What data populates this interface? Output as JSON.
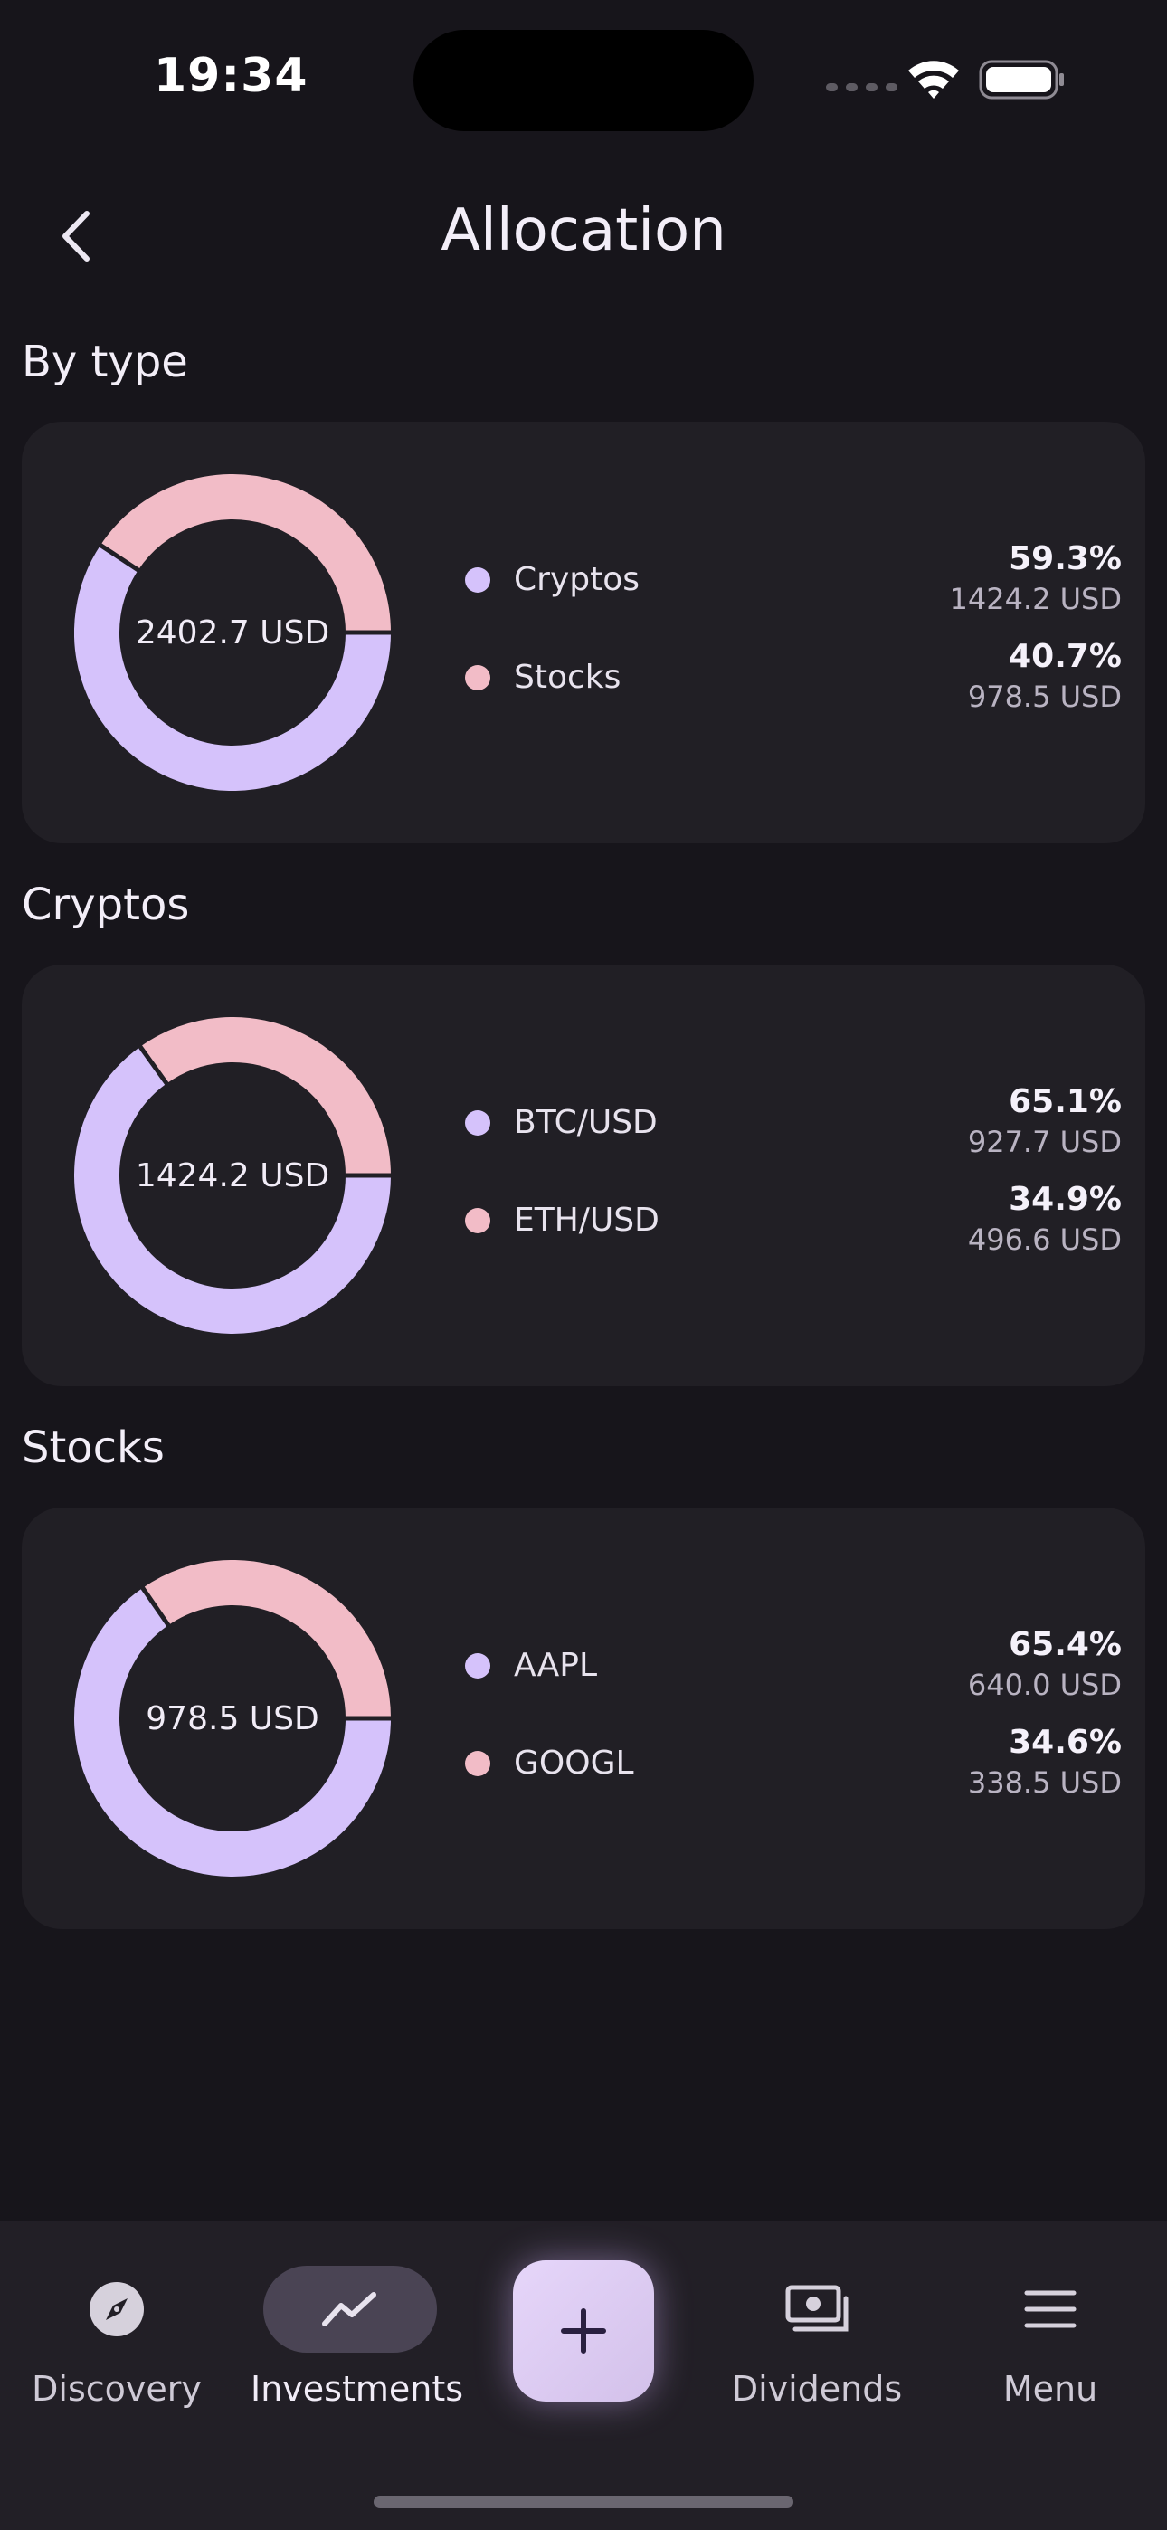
{
  "status_bar": {
    "time": "19:34"
  },
  "header": {
    "title": "Allocation",
    "back_icon": "chevron-left-icon"
  },
  "colors": {
    "primary": "#d5c2fb",
    "secondary": "#f2bcc7"
  },
  "sections": [
    {
      "title": "By type",
      "total": "2402.7 USD",
      "items": [
        {
          "label": "Cryptos",
          "percent": "59.3%",
          "amount": "1424.2 USD",
          "value": 0.593
        },
        {
          "label": "Stocks",
          "percent": "40.7%",
          "amount": "978.5 USD",
          "value": 0.407
        }
      ]
    },
    {
      "title": "Cryptos",
      "total": "1424.2 USD",
      "items": [
        {
          "label": "BTC/USD",
          "percent": "65.1%",
          "amount": "927.7 USD",
          "value": 0.651
        },
        {
          "label": "ETH/USD",
          "percent": "34.9%",
          "amount": "496.6 USD",
          "value": 0.349
        }
      ]
    },
    {
      "title": "Stocks",
      "total": "978.5 USD",
      "items": [
        {
          "label": "AAPL",
          "percent": "65.4%",
          "amount": "640.0 USD",
          "value": 0.654
        },
        {
          "label": "GOOGL",
          "percent": "34.6%",
          "amount": "338.5 USD",
          "value": 0.346
        }
      ]
    }
  ],
  "bottom_nav": {
    "items": [
      {
        "label": "Discovery",
        "icon": "compass-icon"
      },
      {
        "label": "Investments",
        "icon": "trend-chart-icon",
        "active": true
      },
      {
        "label": "",
        "icon": "plus-icon"
      },
      {
        "label": "Dividends",
        "icon": "cash-icon"
      },
      {
        "label": "Menu",
        "icon": "hamburger-menu-icon"
      }
    ]
  }
}
